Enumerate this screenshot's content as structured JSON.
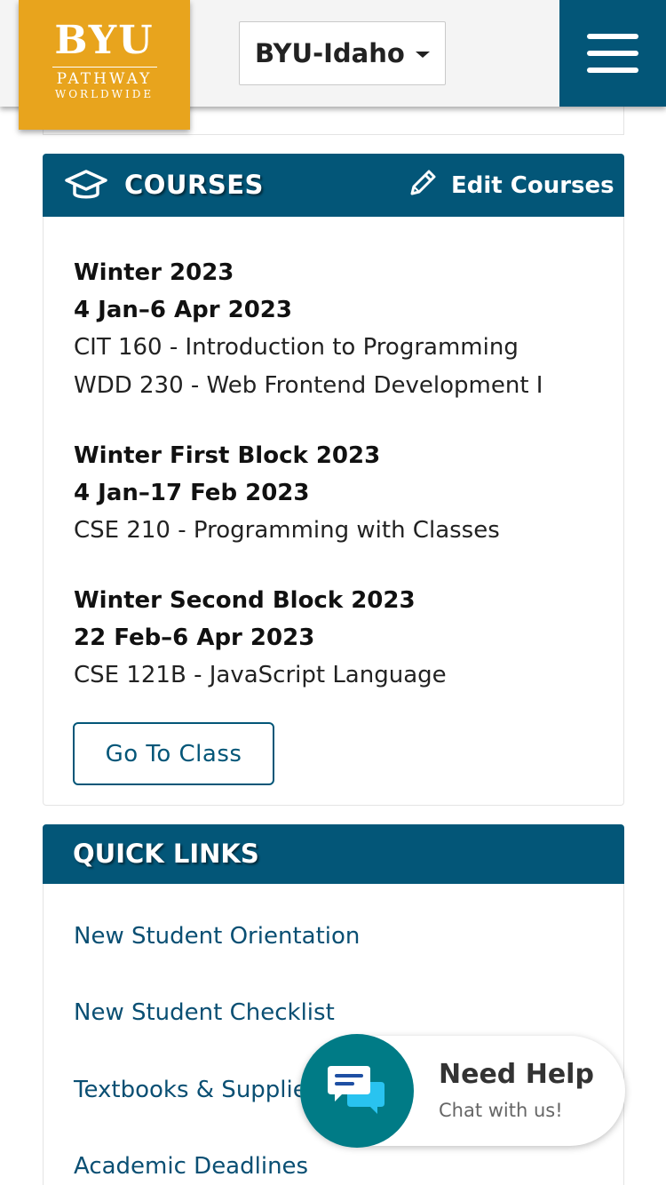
{
  "header": {
    "logo": {
      "line1": "BYU",
      "line2": "PATHWAY",
      "line3": "WORLDWIDE"
    },
    "campus_select": {
      "value": "BYU-Idaho"
    },
    "menu_icon": "hamburger-menu-icon"
  },
  "courses": {
    "title": "COURSES",
    "icon": "graduation-cap-icon",
    "edit_label": "Edit Courses",
    "edit_icon": "pencil-icon",
    "terms": [
      {
        "name": "Winter 2023",
        "dates": "4 Jan–6 Apr 2023",
        "courses": [
          "CIT 160 - Introduction to Programming",
          "WDD 230 - Web Frontend Development I"
        ]
      },
      {
        "name": "Winter First Block 2023",
        "dates": "4 Jan–17 Feb 2023",
        "courses": [
          "CSE 210 - Programming with Classes"
        ]
      },
      {
        "name": "Winter Second Block 2023",
        "dates": "22 Feb–6 Apr 2023",
        "courses": [
          "CSE 121B - JavaScript Language"
        ]
      }
    ],
    "go_to_class_label": "Go To Class"
  },
  "quick_links": {
    "title": "QUICK LINKS",
    "items": [
      "New Student Orientation",
      "New Student Checklist",
      "Textbooks & Supplies",
      "Academic Deadlines"
    ]
  },
  "chat": {
    "title": "Need Help",
    "subtitle": "Chat with us!",
    "icon": "chat-bubbles-icon"
  },
  "colors": {
    "brand_blue": "#035678",
    "logo_gold": "#e8a41d",
    "link_blue": "#0a4f73",
    "chat_teal": "#007b86"
  }
}
